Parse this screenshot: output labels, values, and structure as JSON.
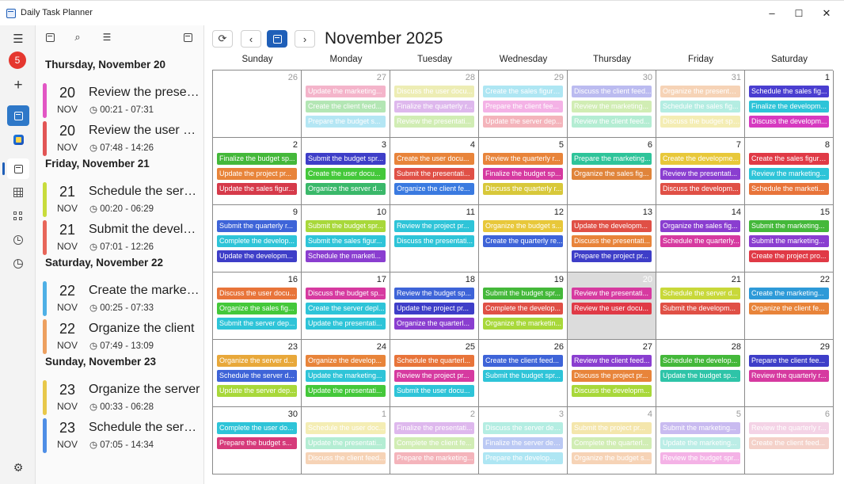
{
  "window": {
    "title": "Daily Task Planner",
    "minimize": "–",
    "maximize": "☐",
    "close": "✕"
  },
  "navrail": {
    "badge": "5"
  },
  "agenda": {
    "groups": [
      {
        "header": "Thursday, November 20",
        "items": [
          {
            "day": "20",
            "month": "NOV",
            "title": "Review the presentation",
            "time": "00:21 - 07:31",
            "color": "#e256c4"
          },
          {
            "day": "20",
            "month": "NOV",
            "title": "Review the user documentation",
            "time": "07:48 - 14:26",
            "color": "#e25555"
          }
        ]
      },
      {
        "header": "Friday, November 21",
        "items": [
          {
            "day": "21",
            "month": "NOV",
            "title": "Schedule the server",
            "time": "00:20 - 06:29",
            "color": "#c8dc3c"
          },
          {
            "day": "21",
            "month": "NOV",
            "title": "Submit the development",
            "time": "07:01 - 12:26",
            "color": "#e8665a"
          }
        ]
      },
      {
        "header": "Saturday, November 22",
        "items": [
          {
            "day": "22",
            "month": "NOV",
            "title": "Create the marketing",
            "time": "00:25 - 07:33",
            "color": "#4eb0e6"
          },
          {
            "day": "22",
            "month": "NOV",
            "title": "Organize the client",
            "time": "07:49 - 13:09",
            "color": "#eda060"
          }
        ]
      },
      {
        "header": "Sunday, November 23",
        "items": [
          {
            "day": "23",
            "month": "NOV",
            "title": "Organize the server",
            "time": "00:33 - 06:28",
            "color": "#e8c84a"
          },
          {
            "day": "23",
            "month": "NOV",
            "title": "Schedule the server",
            "time": "07:05 - 14:34",
            "color": "#4e8ee6"
          }
        ]
      }
    ]
  },
  "calendar": {
    "month_title": "November 2025",
    "weekdays": [
      "Sunday",
      "Monday",
      "Tuesday",
      "Wednesday",
      "Thursday",
      "Friday",
      "Saturday"
    ],
    "today_day": "20",
    "weeks": [
      [
        {
          "day": "26",
          "other": true,
          "events": []
        },
        {
          "day": "27",
          "other": true,
          "events": [
            {
              "text": "Update the marketing...",
              "color": "#e85a8c"
            },
            {
              "text": "Create the client feed...",
              "color": "#58c85a"
            },
            {
              "text": "Prepare the budget s...",
              "color": "#5ac8e8"
            }
          ]
        },
        {
          "day": "28",
          "other": true,
          "events": [
            {
              "text": "Discuss the user docu...",
              "color": "#d8d85a"
            },
            {
              "text": "Finalize the quarterly r...",
              "color": "#b864d8"
            },
            {
              "text": "Review the presentati...",
              "color": "#9ad85a"
            }
          ]
        },
        {
          "day": "29",
          "other": true,
          "events": [
            {
              "text": "Create the sales figure...",
              "color": "#4ec8e6"
            },
            {
              "text": "Prepare the client fee...",
              "color": "#e856c8"
            },
            {
              "text": "Update the server dep...",
              "color": "#e85a6a"
            }
          ]
        },
        {
          "day": "30",
          "other": true,
          "events": [
            {
              "text": "Discuss the client feed...",
              "color": "#6a6ae0"
            },
            {
              "text": "Review the marketing...",
              "color": "#9ad85a"
            },
            {
              "text": "Review the client feed...",
              "color": "#5ad8a0"
            }
          ]
        },
        {
          "day": "31",
          "other": true,
          "events": [
            {
              "text": "Organize the presentat...",
              "color": "#eda060"
            },
            {
              "text": "Schedule the sales fig...",
              "color": "#5ad8c0"
            },
            {
              "text": "Discuss the budget spr...",
              "color": "#e8d85a"
            }
          ]
        },
        {
          "day": "1",
          "other": false,
          "events": [
            {
              "text": "Schedule the sales fig...",
              "color": "#4a3ed0"
            },
            {
              "text": "Finalize the developm...",
              "color": "#2ec4d8"
            },
            {
              "text": "Discuss the developm...",
              "color": "#d63ac0"
            }
          ]
        }
      ],
      [
        {
          "day": "2",
          "other": false,
          "events": [
            {
              "text": "Finalize the budget sp...",
              "color": "#44b83a"
            },
            {
              "text": "Update the project pr...",
              "color": "#e8843a"
            },
            {
              "text": "Update the sales figur...",
              "color": "#d63a4a"
            }
          ]
        },
        {
          "day": "3",
          "other": false,
          "events": [
            {
              "text": "Submit the budget spr...",
              "color": "#3e3ec8"
            },
            {
              "text": "Create the user docu...",
              "color": "#44c83a"
            },
            {
              "text": "Organize the server d...",
              "color": "#3ab86a"
            }
          ]
        },
        {
          "day": "4",
          "other": false,
          "events": [
            {
              "text": "Create the user docu...",
              "color": "#e8843a"
            },
            {
              "text": "Submit the presentati...",
              "color": "#e05046"
            },
            {
              "text": "Organize the client fe...",
              "color": "#3a7ae0"
            }
          ]
        },
        {
          "day": "5",
          "other": false,
          "events": [
            {
              "text": "Review the quarterly r...",
              "color": "#e8843a"
            },
            {
              "text": "Finalize the budget sp...",
              "color": "#d63aa0"
            },
            {
              "text": "Discuss the quarterly r...",
              "color": "#d8c83a"
            }
          ]
        },
        {
          "day": "6",
          "other": false,
          "events": [
            {
              "text": "Prepare the marketing...",
              "color": "#2ec49a"
            },
            {
              "text": "Organize the sales fig...",
              "color": "#e0843a"
            }
          ]
        },
        {
          "day": "7",
          "other": false,
          "events": [
            {
              "text": "Create the developme...",
              "color": "#e8c83a"
            },
            {
              "text": "Review the presentati...",
              "color": "#8a3ed0"
            },
            {
              "text": "Discuss the developm...",
              "color": "#e05046"
            }
          ]
        },
        {
          "day": "8",
          "other": false,
          "events": [
            {
              "text": "Create the sales figure...",
              "color": "#e03a46"
            },
            {
              "text": "Review the marketing...",
              "color": "#2ec4d8"
            },
            {
              "text": "Schedule the marketi...",
              "color": "#e8743a"
            }
          ]
        }
      ],
      [
        {
          "day": "9",
          "other": false,
          "events": [
            {
              "text": "Submit the quarterly r...",
              "color": "#3e64d8"
            },
            {
              "text": "Complete the develop...",
              "color": "#2ec4d8"
            },
            {
              "text": "Update the developm...",
              "color": "#3e3ec8"
            }
          ]
        },
        {
          "day": "10",
          "other": false,
          "events": [
            {
              "text": "Submit the budget spr...",
              "color": "#a8d83a"
            },
            {
              "text": "Submit the sales figur...",
              "color": "#2ec4d8"
            },
            {
              "text": "Schedule the marketi...",
              "color": "#8a3ed0"
            }
          ]
        },
        {
          "day": "11",
          "other": false,
          "events": [
            {
              "text": "Review the project pr...",
              "color": "#2ec4d8"
            },
            {
              "text": "Discuss the presentati...",
              "color": "#2ec4d8"
            }
          ]
        },
        {
          "day": "12",
          "other": false,
          "events": [
            {
              "text": "Organize the budget s...",
              "color": "#e8c83a"
            },
            {
              "text": "Create the quarterly re...",
              "color": "#3e64d8"
            }
          ]
        },
        {
          "day": "13",
          "other": false,
          "events": [
            {
              "text": "Update the developm...",
              "color": "#e05046"
            },
            {
              "text": "Discuss the presentati...",
              "color": "#e8843a"
            },
            {
              "text": "Prepare the project pr...",
              "color": "#3e3ec8"
            }
          ]
        },
        {
          "day": "14",
          "other": false,
          "events": [
            {
              "text": "Organize the sales fig...",
              "color": "#8a3ed0"
            },
            {
              "text": "Schedule the quarterly...",
              "color": "#d63aa0"
            }
          ]
        },
        {
          "day": "15",
          "other": false,
          "events": [
            {
              "text": "Submit the marketing...",
              "color": "#44b83a"
            },
            {
              "text": "Submit the marketing...",
              "color": "#8a3ed0"
            },
            {
              "text": "Create the project pro...",
              "color": "#e03a46"
            }
          ]
        }
      ],
      [
        {
          "day": "16",
          "other": false,
          "events": [
            {
              "text": "Discuss the user docu...",
              "color": "#e8743a"
            },
            {
              "text": "Organize the sales fig...",
              "color": "#44c83a"
            },
            {
              "text": "Submit the server dep...",
              "color": "#2ec4d8"
            }
          ]
        },
        {
          "day": "17",
          "other": false,
          "events": [
            {
              "text": "Discuss the budget sp...",
              "color": "#d63aa0"
            },
            {
              "text": "Create the server depl...",
              "color": "#2ec4d8"
            },
            {
              "text": "Update the presentati...",
              "color": "#2ec4d8"
            }
          ]
        },
        {
          "day": "18",
          "other": false,
          "events": [
            {
              "text": "Review the budget sp...",
              "color": "#3e64d8"
            },
            {
              "text": "Update the project pr...",
              "color": "#3e3ec8"
            },
            {
              "text": "Organize the quarterl...",
              "color": "#8a3ed0"
            }
          ]
        },
        {
          "day": "19",
          "other": false,
          "events": [
            {
              "text": "Submit the budget spr...",
              "color": "#44b83a"
            },
            {
              "text": "Complete the develop...",
              "color": "#e05046"
            },
            {
              "text": "Organize the marketin...",
              "color": "#a8d83a"
            }
          ]
        },
        {
          "day": "20",
          "other": false,
          "today": true,
          "events": [
            {
              "text": "Review the presentati...",
              "color": "#d63aa0"
            },
            {
              "text": "Review the user docu...",
              "color": "#e03a46"
            }
          ]
        },
        {
          "day": "21",
          "other": false,
          "events": [
            {
              "text": "Schedule the server d...",
              "color": "#c8d83a"
            },
            {
              "text": "Submit the developm...",
              "color": "#e05046"
            }
          ]
        },
        {
          "day": "22",
          "other": false,
          "events": [
            {
              "text": "Create the marketing...",
              "color": "#2e9ad8"
            },
            {
              "text": "Organize the client fe...",
              "color": "#e8843a"
            }
          ]
        }
      ],
      [
        {
          "day": "23",
          "other": false,
          "events": [
            {
              "text": "Organize the server d...",
              "color": "#e8a83a"
            },
            {
              "text": "Schedule the server d...",
              "color": "#3e64d8"
            },
            {
              "text": "Update the server dep...",
              "color": "#a8d83a"
            }
          ]
        },
        {
          "day": "24",
          "other": false,
          "events": [
            {
              "text": "Organize the develop...",
              "color": "#e8843a"
            },
            {
              "text": "Update the marketing...",
              "color": "#2ec4d8"
            },
            {
              "text": "Update the presentati...",
              "color": "#44c83a"
            }
          ]
        },
        {
          "day": "25",
          "other": false,
          "events": [
            {
              "text": "Schedule the quarterl...",
              "color": "#e8743a"
            },
            {
              "text": "Review the project pr...",
              "color": "#d63aa0"
            },
            {
              "text": "Submit the user docu...",
              "color": "#2ec4d8"
            }
          ]
        },
        {
          "day": "26",
          "other": false,
          "events": [
            {
              "text": "Create the client feed...",
              "color": "#3e64d8"
            },
            {
              "text": "Submit the budget spr...",
              "color": "#2ec4d8"
            }
          ]
        },
        {
          "day": "27",
          "other": false,
          "events": [
            {
              "text": "Review the client feed...",
              "color": "#8a3ed0"
            },
            {
              "text": "Discuss the project pr...",
              "color": "#e8843a"
            },
            {
              "text": "Discuss the developm...",
              "color": "#a8d83a"
            }
          ]
        },
        {
          "day": "28",
          "other": false,
          "events": [
            {
              "text": "Schedule the develop...",
              "color": "#44b83a"
            },
            {
              "text": "Update the budget sp...",
              "color": "#2ec4a8"
            }
          ]
        },
        {
          "day": "29",
          "other": false,
          "events": [
            {
              "text": "Prepare the client fee...",
              "color": "#3e3ec8"
            },
            {
              "text": "Review the quarterly r...",
              "color": "#d63aa0"
            }
          ]
        }
      ],
      [
        {
          "day": "30",
          "other": false,
          "events": [
            {
              "text": "Complete the user do...",
              "color": "#2ec4d8"
            },
            {
              "text": "Prepare the budget s...",
              "color": "#d63a7a"
            }
          ]
        },
        {
          "day": "1",
          "other": true,
          "events": [
            {
              "text": "Schedule the user doc...",
              "color": "#e8d85a"
            },
            {
              "text": "Update the presentati...",
              "color": "#5ad8a0"
            },
            {
              "text": "Discuss the client feed...",
              "color": "#eda060"
            }
          ]
        },
        {
          "day": "2",
          "other": true,
          "events": [
            {
              "text": "Finalize the presentati...",
              "color": "#b864d8"
            },
            {
              "text": "Complete the client fe...",
              "color": "#9ad85a"
            },
            {
              "text": "Prepare the marketing...",
              "color": "#e85a6a"
            }
          ]
        },
        {
          "day": "3",
          "other": true,
          "events": [
            {
              "text": "Discuss the server dep...",
              "color": "#5ad8c0"
            },
            {
              "text": "Finalize the server dep...",
              "color": "#6a8ae8"
            },
            {
              "text": "Prepare the develop...",
              "color": "#4ec8e6"
            }
          ]
        },
        {
          "day": "4",
          "other": true,
          "events": [
            {
              "text": "Submit the project pr...",
              "color": "#e8c84a"
            },
            {
              "text": "Complete the quarterl...",
              "color": "#9ad85a"
            },
            {
              "text": "Organize the budget s...",
              "color": "#eda060"
            }
          ]
        },
        {
          "day": "5",
          "other": true,
          "events": [
            {
              "text": "Submit the marketing...",
              "color": "#8a6ae0"
            },
            {
              "text": "Update the marketing...",
              "color": "#6ad8c8"
            },
            {
              "text": "Review the budget spr...",
              "color": "#e856c8"
            }
          ]
        },
        {
          "day": "6",
          "other": true,
          "events": [
            {
              "text": "Review the quarterly r...",
              "color": "#e8a0c8"
            },
            {
              "text": "Create the client feed...",
              "color": "#e89a8a"
            }
          ]
        }
      ]
    ]
  }
}
